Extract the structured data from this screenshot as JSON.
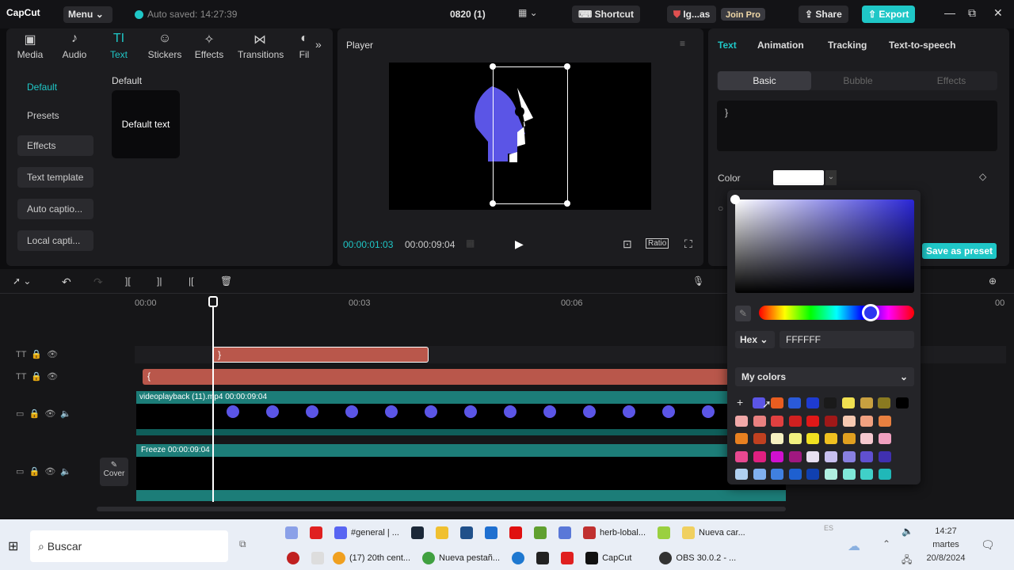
{
  "titlebar": {
    "logo": "CapCut",
    "menu": "Menu",
    "autosave": "Auto saved: 14:27:39",
    "project": "0820 (1)",
    "shortcut": "Shortcut",
    "user": "Ig...as",
    "join_pro": "Join Pro",
    "share": "Share",
    "export": "Export"
  },
  "tools": [
    {
      "label": "Media",
      "icon": "media-icon"
    },
    {
      "label": "Audio",
      "icon": "audio-icon"
    },
    {
      "label": "Text",
      "icon": "text-icon"
    },
    {
      "label": "Stickers",
      "icon": "stickers-icon"
    },
    {
      "label": "Effects",
      "icon": "effects-icon"
    },
    {
      "label": "Transitions",
      "icon": "transitions-icon"
    },
    {
      "label": "Fil",
      "icon": "filters-icon"
    }
  ],
  "sidebar": {
    "items": [
      "Default",
      "Presets",
      "Effects",
      "Text template",
      "Auto captio...",
      "Local capti..."
    ]
  },
  "library": {
    "heading": "Default",
    "card": "Default text"
  },
  "player": {
    "title": "Player",
    "current": "00:00:01:03",
    "total": "00:00:09:04",
    "ratio": "Ratio"
  },
  "inspector": {
    "tabs": [
      "Text",
      "Animation",
      "Tracking",
      "Text-to-speech"
    ],
    "sub": [
      "Basic",
      "Bubble",
      "Effects"
    ],
    "text_value": "}",
    "color_label": "Color",
    "save_preset": "Save as preset"
  },
  "picker": {
    "hex_mode": "Hex",
    "hex_value": "FFFFFF",
    "my_colors": "My colors",
    "add": "+"
  },
  "timeline": {
    "ticks": [
      "00:00",
      "00:03",
      "00:06",
      "00"
    ],
    "clip1_text": "}",
    "clip2_text": "{",
    "video_label": "videoplayback (11).mp4  00:00:09:04",
    "freeze_label": "Freeze  00:00:09:04",
    "cover": "Cover"
  },
  "taskbar": {
    "search": "Buscar",
    "items_top": [
      "#general | ...",
      "herb-lobal...",
      "Nueva car..."
    ],
    "items_bottom": [
      "(17) 20th cent...",
      "Nueva pestañ...",
      "CapCut",
      "OBS 30.0.2 - ..."
    ],
    "time": "14:27",
    "day": "martes",
    "date": "20/8/2024",
    "lang": "ES"
  },
  "colors": {
    "accent": "#1fc7c7",
    "red_clip": "#b9574b",
    "teal_clip": "#1c7d78",
    "purple": "#5b55e6"
  }
}
